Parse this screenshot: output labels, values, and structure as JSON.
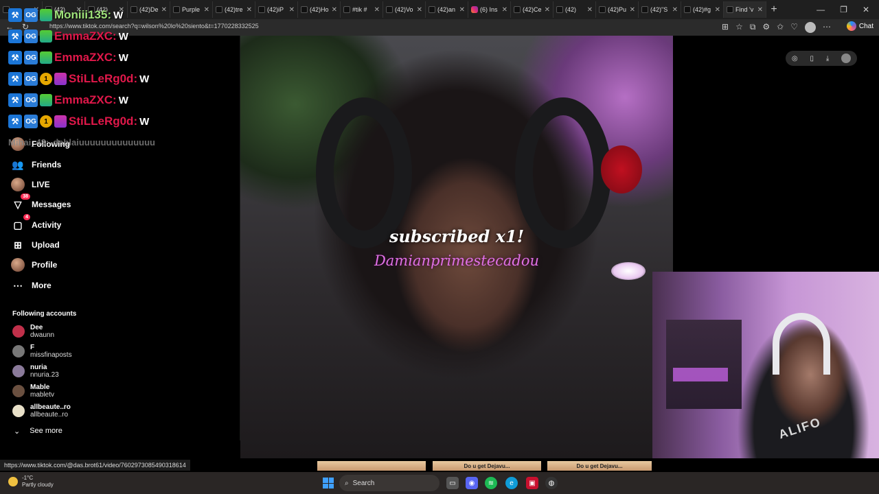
{
  "browser": {
    "tabs": [
      {
        "label": "",
        "icon": "tiktok-icon"
      },
      {
        "label": "(42)",
        "icon": "tiktok-icon"
      },
      {
        "label": "(42)",
        "icon": "tiktok-icon"
      },
      {
        "label": "(42)De",
        "icon": "tiktok-icon"
      },
      {
        "label": "Purple",
        "icon": "tiktok-icon"
      },
      {
        "label": "(42)tre",
        "icon": "tiktok-icon"
      },
      {
        "label": "(42)iP",
        "icon": "tiktok-icon"
      },
      {
        "label": "(42)Ho",
        "icon": "tiktok-icon"
      },
      {
        "label": "#tik #",
        "icon": "tiktok-icon"
      },
      {
        "label": "(42)Vo",
        "icon": "tiktok-icon"
      },
      {
        "label": "(42)an",
        "icon": "tiktok-icon"
      },
      {
        "label": "(6) Ins",
        "icon": "instagram-icon"
      },
      {
        "label": "(42)Ce",
        "icon": "tiktok-icon"
      },
      {
        "label": "(42)",
        "icon": "tiktok-icon"
      },
      {
        "label": "(42)Pu",
        "icon": "tiktok-icon"
      },
      {
        "label": "(42)\"S",
        "icon": "tiktok-icon"
      },
      {
        "label": "(42)#g",
        "icon": "tiktok-icon"
      },
      {
        "label": "Find 'v",
        "icon": "tiktok-icon"
      }
    ],
    "url": "https://www.tiktok.com/search?q=wilson%20lo%20siento&t=1770228332525",
    "chat_label": "Chat"
  },
  "sidebar": {
    "nav": [
      {
        "label": "Following",
        "icon": "following-avatar-icon"
      },
      {
        "label": "Friends",
        "icon": "friends-icon"
      },
      {
        "label": "LIVE",
        "icon": "live-avatar-icon"
      },
      {
        "label": "Messages",
        "icon": "messages-icon",
        "badge": "38"
      },
      {
        "label": "Activity",
        "icon": "activity-icon",
        "badge": "4"
      },
      {
        "label": "Upload",
        "icon": "upload-icon"
      },
      {
        "label": "Profile",
        "icon": "profile-avatar-icon"
      },
      {
        "label": "More",
        "icon": "more-icon"
      }
    ],
    "following_title": "Following accounts",
    "accounts": [
      {
        "name": "Dee",
        "handle": "dwaunn",
        "color": "#c0304a"
      },
      {
        "name": "F",
        "handle": "missfinaposts",
        "color": "#777777"
      },
      {
        "name": "nuria",
        "handle": "nnuria.23",
        "color": "#8a7a9a"
      },
      {
        "name": "Mable",
        "handle": "mabletv",
        "color": "#6a5040"
      },
      {
        "name": "allbeaute..ro",
        "handle": "allbeaute..ro",
        "color": "#e8e0c8"
      }
    ],
    "see_more": "See more"
  },
  "chat_overlay": {
    "lines": [
      {
        "user": "Moniii135:",
        "message": "W",
        "user_color": "green"
      },
      {
        "user": "EmmaZXC:",
        "message": "W",
        "user_color": "red"
      },
      {
        "user": "EmmaZXC:",
        "message": "W",
        "user_color": "red"
      },
      {
        "user": "StiLLeRg0d:",
        "message": "W",
        "user_color": "red",
        "coin": "1"
      },
      {
        "user": "EmmaZXC:",
        "message": "W",
        "user_color": "red"
      },
      {
        "user": "StiLLeRg0d:",
        "message": "W",
        "user_color": "red",
        "coin": "1"
      }
    ],
    "faded": {
      "user": "Mihai_48:",
      "message": "dablaiuuuuuuuuuuuuuu"
    },
    "badge_og": "OG"
  },
  "video": {
    "overlay_line1": "subscribed x1!",
    "overlay_line2": "Damianprimestecadou"
  },
  "status_url": "https://www.tiktok.com/@das.brot61/video/7602973085490318614",
  "thumbnails": [
    "",
    "Do u get Dejavu...",
    "Do u get Dejavu..."
  ],
  "webcam": {
    "shirt_text": "ALIFO"
  },
  "taskbar": {
    "weather_temp": "-1°C",
    "weather_desc": "Partly cloudy",
    "search_label": "Search"
  }
}
